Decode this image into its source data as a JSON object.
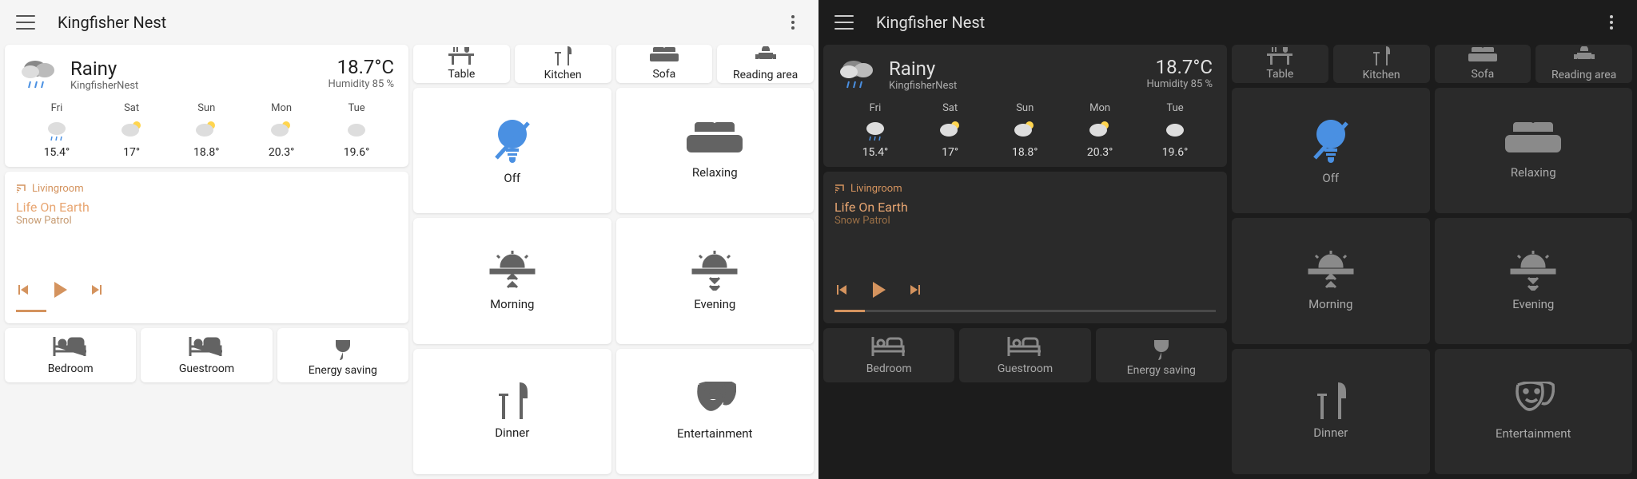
{
  "header": {
    "title": "Kingfisher Nest"
  },
  "weather": {
    "condition": "Rainy",
    "location": "KingfisherNest",
    "temp": "18.7°C",
    "humidity": "Humidity 85 %",
    "forecast": [
      {
        "day": "Fri",
        "temp": "15.4°"
      },
      {
        "day": "Sat",
        "temp": "17°"
      },
      {
        "day": "Sun",
        "temp": "18.8°"
      },
      {
        "day": "Mon",
        "temp": "20.3°"
      },
      {
        "day": "Tue",
        "temp": "19.6°"
      }
    ]
  },
  "media": {
    "room": "Livingroom",
    "title": "Life On Earth",
    "artist": "Snow Patrol"
  },
  "bottom_tiles": {
    "bedroom": "Bedroom",
    "guestroom": "Guestroom",
    "energy": "Energy saving"
  },
  "right_top": {
    "table": "Table",
    "kitchen": "Kitchen",
    "sofa": "Sofa",
    "reading": "Reading area"
  },
  "scenes": {
    "off": "Off",
    "relaxing": "Relaxing",
    "morning": "Morning",
    "evening": "Evening",
    "dinner": "Dinner",
    "entertainment": "Entertainment"
  }
}
